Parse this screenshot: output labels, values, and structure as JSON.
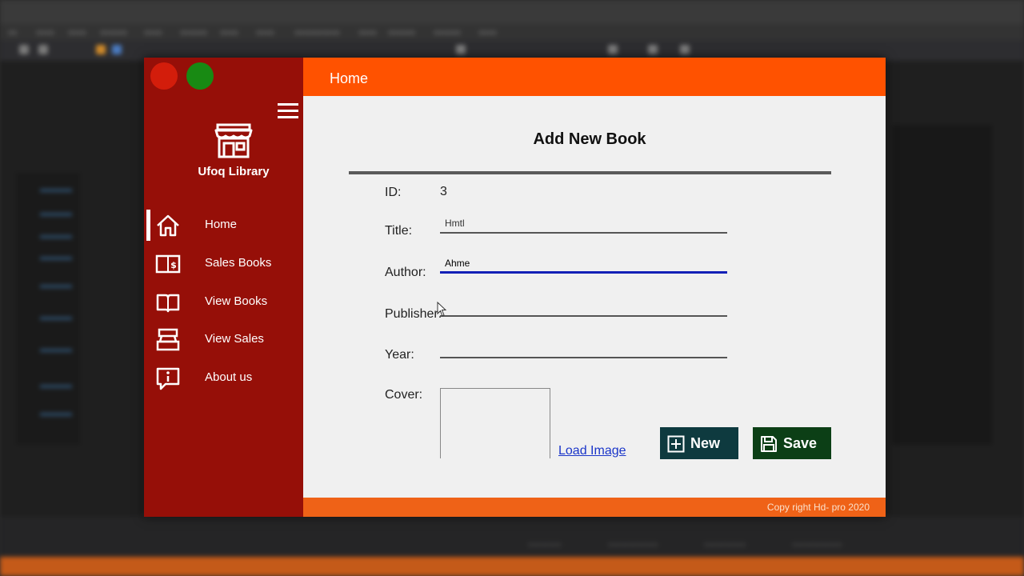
{
  "app": {
    "library_name": "Ufoq Library",
    "header_title": "Home",
    "colors": {
      "sidebar": "#960f08",
      "header": "#ff5200",
      "footer": "#ef6217",
      "new_button": "#0e3a3f",
      "save_button": "#0c3f16",
      "active_underline": "#1320b6"
    }
  },
  "sidebar": {
    "items": [
      {
        "label": "Home",
        "icon": "home-icon",
        "active": true
      },
      {
        "label": "Sales Books",
        "icon": "money-book-icon"
      },
      {
        "label": "View Books",
        "icon": "open-book-icon"
      },
      {
        "label": "View Sales",
        "icon": "register-icon"
      },
      {
        "label": "About us",
        "icon": "info-bubble-icon"
      }
    ]
  },
  "form": {
    "title": "Add New Book",
    "id_label": "ID:",
    "id_value": "3",
    "title_label": "Title:",
    "title_value": "Hmtl",
    "author_label": "Author:",
    "author_value": "Ahme",
    "publisher_label": "Publisher:",
    "publisher_value": "",
    "year_label": "Year:",
    "year_value": "",
    "cover_label": "Cover:",
    "load_image": "Load Image",
    "new_button": "New",
    "save_button": "Save"
  },
  "footer": {
    "copyright": "Copy right Hd- pro 2020"
  }
}
